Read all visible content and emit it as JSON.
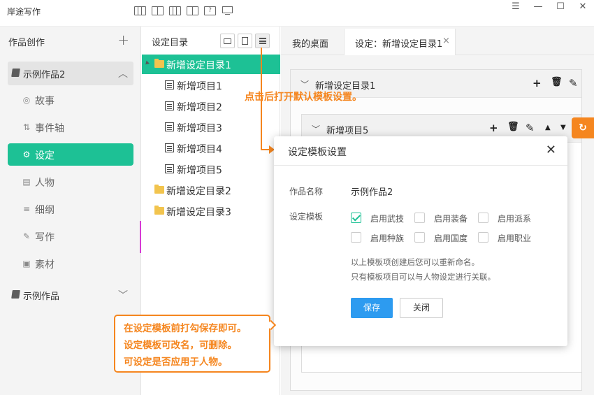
{
  "app": {
    "title": "岸途写作"
  },
  "window": {
    "menu": "☰",
    "minimize": "—",
    "maximize": "☐",
    "close": "✕"
  },
  "sidebar": {
    "header": "作品创作",
    "add": "+",
    "book_active": "示例作品2",
    "book_other": "示例作品",
    "items": [
      {
        "label": "故事",
        "icon": "globe-icon",
        "glyph": "◎"
      },
      {
        "label": "事件轴",
        "icon": "sort-icon",
        "glyph": "⇅"
      },
      {
        "label": "设定",
        "icon": "gears-icon",
        "glyph": "⚙"
      },
      {
        "label": "人物",
        "icon": "id-card-icon",
        "glyph": "▤"
      },
      {
        "label": "细纲",
        "icon": "list-icon",
        "glyph": "≡"
      },
      {
        "label": "写作",
        "icon": "pencil-icon",
        "glyph": "✎"
      },
      {
        "label": "素材",
        "icon": "image-icon",
        "glyph": "▣"
      }
    ]
  },
  "tree": {
    "title": "设定目录",
    "rows": [
      {
        "label": "新增设定目录1",
        "type": "folder",
        "selected": true
      },
      {
        "label": "新增项目1",
        "type": "doc"
      },
      {
        "label": "新增项目2",
        "type": "doc"
      },
      {
        "label": "新增项目3",
        "type": "doc"
      },
      {
        "label": "新增项目4",
        "type": "doc"
      },
      {
        "label": "新增项目5",
        "type": "doc"
      },
      {
        "label": "新增设定目录2",
        "type": "folder"
      },
      {
        "label": "新增设定目录3",
        "type": "folder"
      }
    ]
  },
  "tabs": [
    {
      "label": "我的桌面"
    },
    {
      "label": "设定：新增设定目录1",
      "active": true,
      "close": "×"
    }
  ],
  "main": {
    "section1": "新增设定目录1",
    "section2": "新增项目5",
    "chevron": "﹀",
    "add": "+",
    "delete": "🗑",
    "edit": "✎",
    "up": "▲",
    "down": "▼",
    "refresh": "↻"
  },
  "callouts": {
    "top": "点击后打开默认模板设置。",
    "bottom": [
      "在设定模板前打勾保存即可。",
      "设定模板可改名，可删除。",
      "可设定是否应用于人物。"
    ]
  },
  "dialog": {
    "title": "设定模板设置",
    "close": "✕",
    "work_label": "作品名称",
    "work_value": "示例作品2",
    "template_label": "设定模板",
    "options": [
      {
        "label": "启用武技",
        "checked": true
      },
      {
        "label": "启用装备",
        "checked": false
      },
      {
        "label": "启用派系",
        "checked": false
      },
      {
        "label": "启用种族",
        "checked": false
      },
      {
        "label": "启用国度",
        "checked": false
      },
      {
        "label": "启用职业",
        "checked": false
      }
    ],
    "hint1": "以上模板项创建后您可以重新命名。",
    "hint2": "只有模板项目可以与人物设定进行关联。",
    "save": "保存",
    "cancel": "关闭"
  },
  "colors": {
    "accent": "#1dc195",
    "callout": "#f5861f",
    "primary_button": "#2d9bf0",
    "folder": "#f2c44e"
  }
}
